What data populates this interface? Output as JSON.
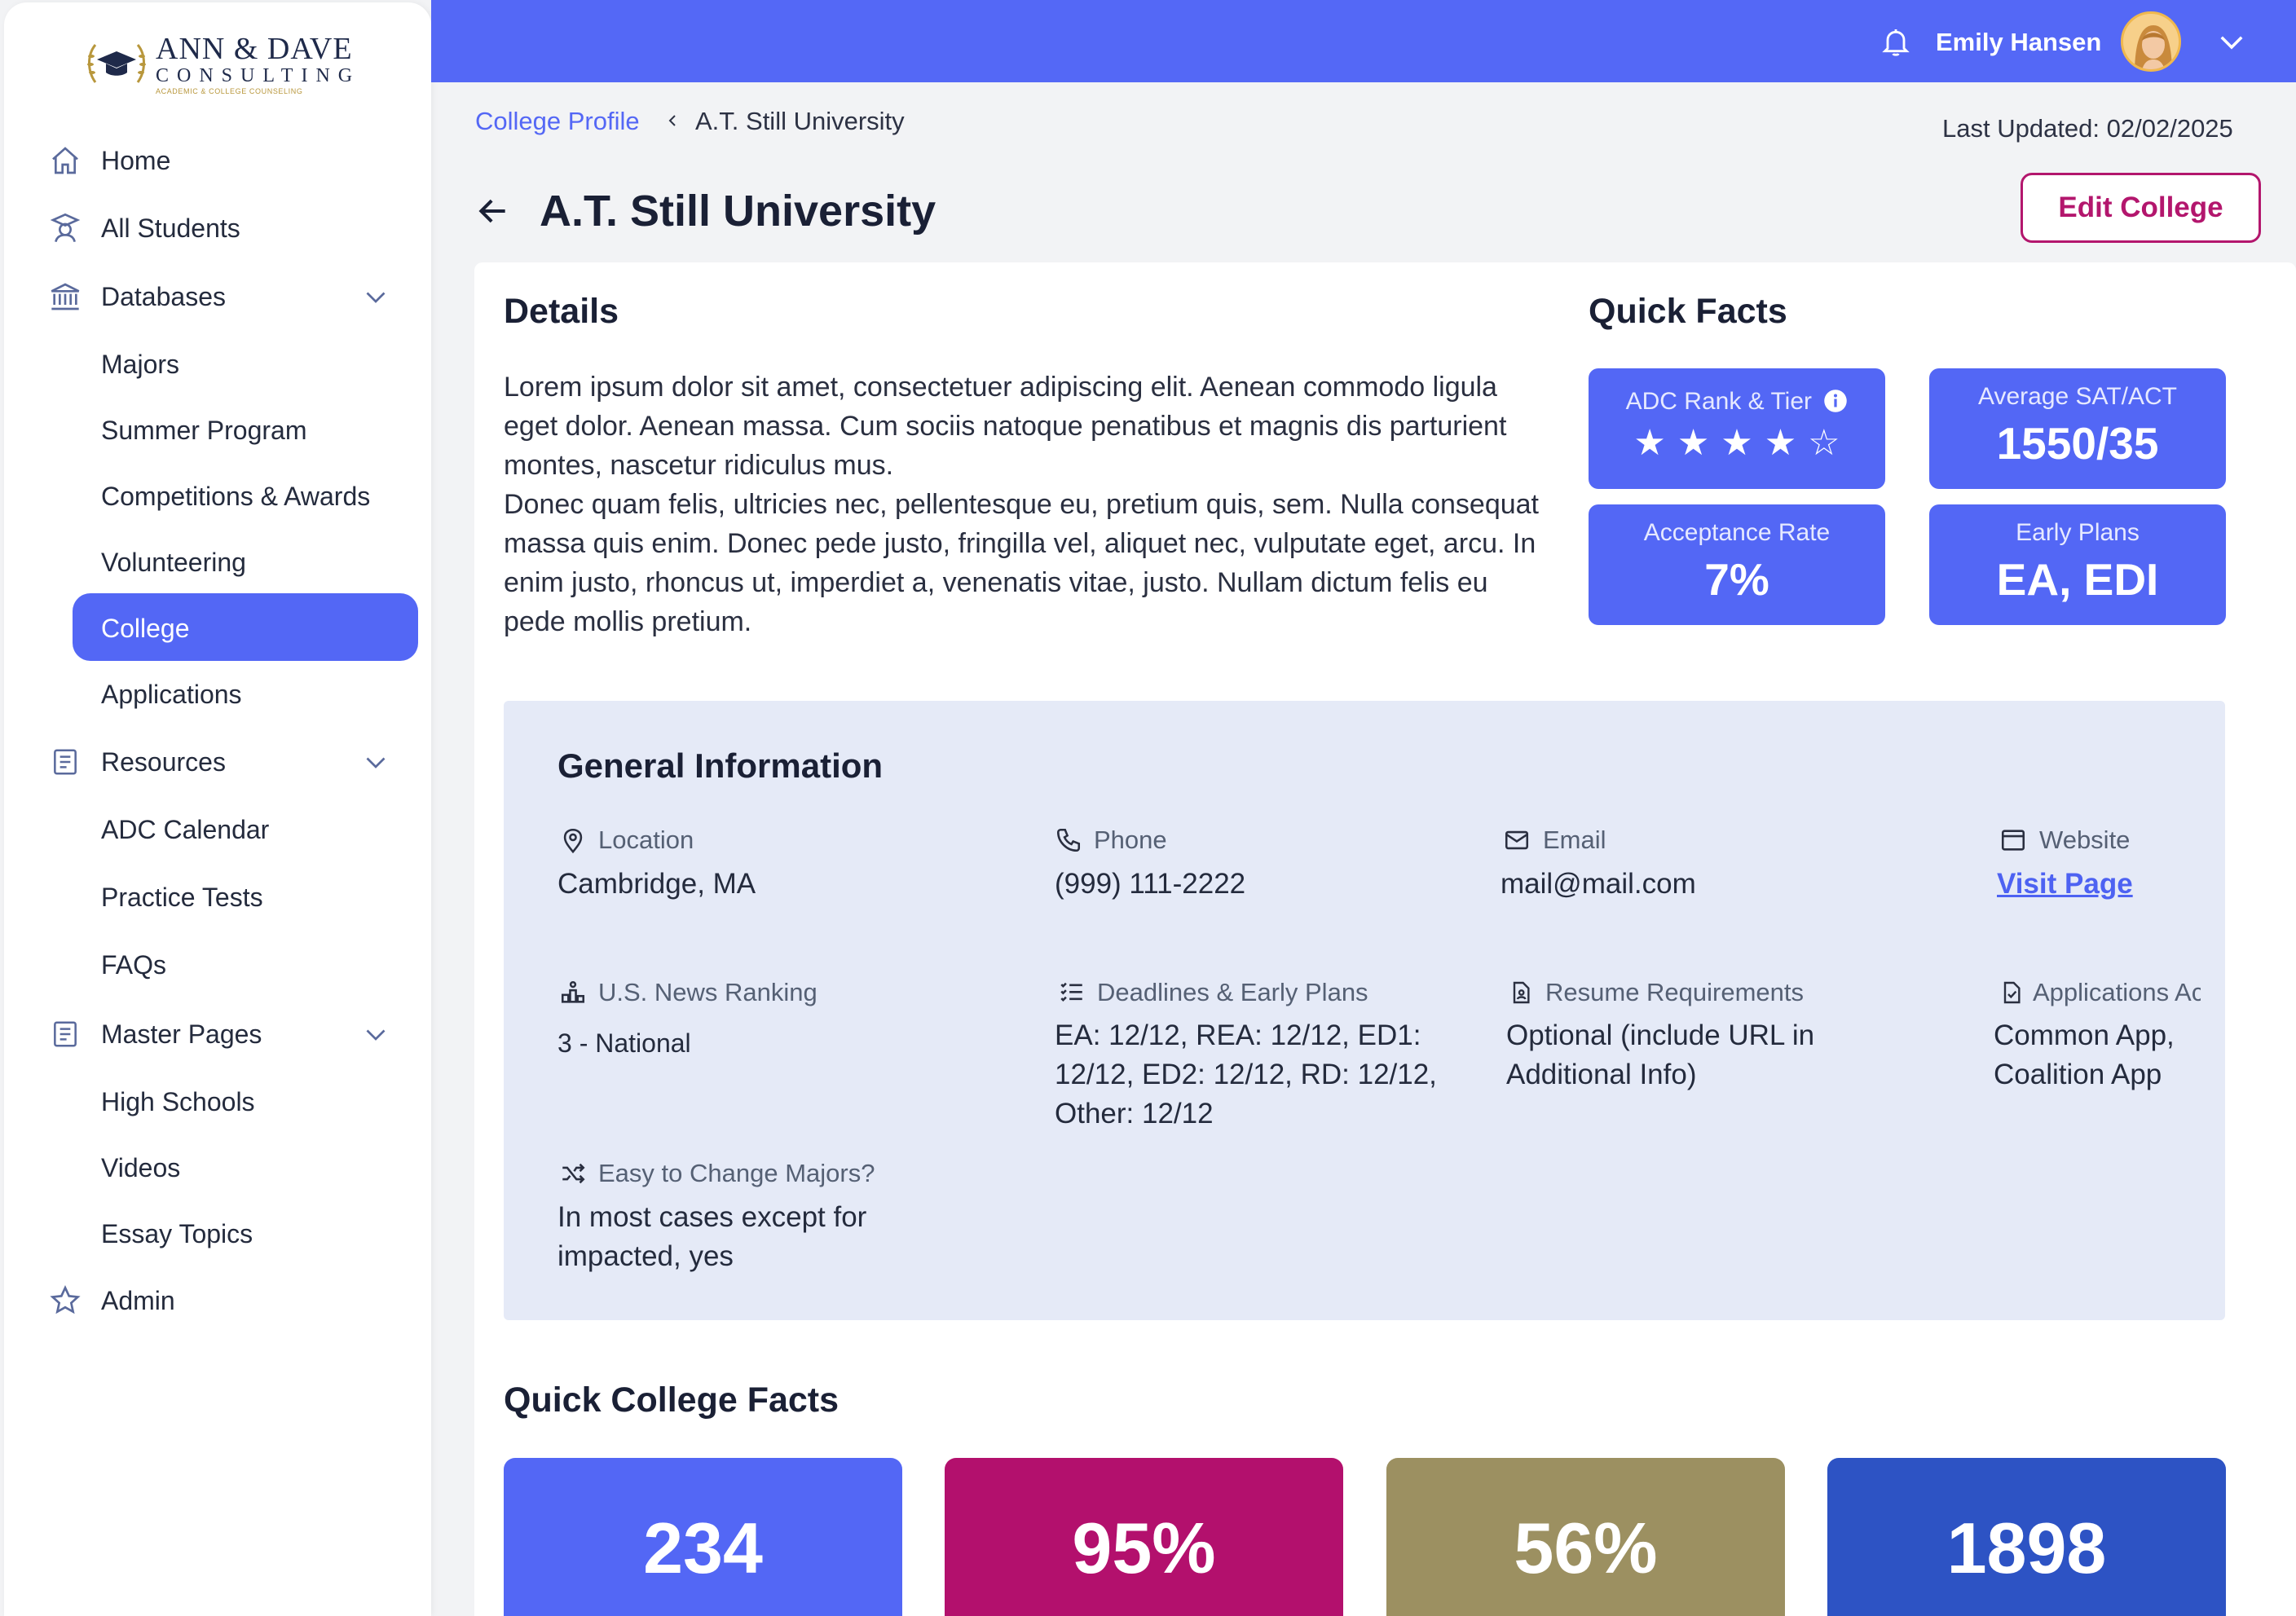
{
  "logo": {
    "line1": "ANN & DAVE",
    "line2": "CONSULTING",
    "line3": "ACADEMIC & COLLEGE COUNSELING"
  },
  "sidebar": {
    "items": [
      {
        "label": "Home",
        "icon": "home-icon"
      },
      {
        "label": "All Students",
        "icon": "student-icon"
      },
      {
        "label": "Databases",
        "icon": "bank-icon"
      },
      {
        "label": "Majors"
      },
      {
        "label": "Summer Program"
      },
      {
        "label": "Competitions & Awards"
      },
      {
        "label": "Volunteering"
      },
      {
        "label": "College"
      },
      {
        "label": "Applications"
      },
      {
        "label": "Resources",
        "icon": "document-icon"
      },
      {
        "label": "ADC Calendar"
      },
      {
        "label": "Practice Tests"
      },
      {
        "label": "FAQs"
      },
      {
        "label": "Master Pages",
        "icon": "document-icon"
      },
      {
        "label": "High Schools"
      },
      {
        "label": "Videos"
      },
      {
        "label": "Essay Topics"
      },
      {
        "label": "Admin",
        "icon": "star-icon"
      }
    ]
  },
  "header": {
    "user_name": "Emily Hansen",
    "accent": "#5468f6"
  },
  "breadcrumb": {
    "parent": "College Profile",
    "current": "A.T. Still University"
  },
  "last_updated": "Last Updated: 02/02/2025",
  "page_title": "A.T. Still University",
  "edit_button": "Edit College",
  "details": {
    "heading": "Details",
    "paragraph1": "Lorem ipsum dolor sit amet, consectetuer adipiscing elit. Aenean commodo ligula eget dolor. Aenean massa. Cum sociis natoque penatibus et magnis dis parturient montes, nascetur ridiculus mus.",
    "paragraph2": "Donec quam felis, ultricies nec, pellentesque eu, pretium quis, sem. Nulla consequat massa quis enim. Donec pede justo, fringilla vel, aliquet nec, vulputate eget, arcu. In enim justo, rhoncus ut, imperdiet a, venenatis vitae, justo. Nullam dictum felis eu pede mollis pretium."
  },
  "quick_facts": {
    "heading": "Quick Facts",
    "rank_label": "ADC Rank & Tier",
    "rank_stars": 4,
    "rank_stars_max": 5,
    "sat_label": "Average SAT/ACT",
    "sat_value": "1550/35",
    "acceptance_label": "Acceptance Rate",
    "acceptance_value": "7%",
    "early_label": "Early Plans",
    "early_value": "EA, EDI"
  },
  "general": {
    "heading": "General Information",
    "location_label": "Location",
    "location_value": "Cambridge, MA",
    "phone_label": "Phone",
    "phone_value": "(999) 111-2222",
    "email_label": "Email",
    "email_value": "mail@mail.com",
    "website_label": "Website",
    "website_value": "Visit Page",
    "ranking_label": "U.S. News Ranking",
    "ranking_value": "3 - National",
    "deadlines_label": "Deadlines & Early Plans",
    "deadlines_value": "EA: 12/12, REA: 12/12, ED1: 12/12, ED2: 12/12, RD: 12/12, Other: 12/12",
    "resume_label": "Resume Requirements",
    "resume_value": "Optional (include URL in Additional Info)",
    "apps_label": "Applications Accepted",
    "apps_value": "Common App, Coalition App",
    "majors_label": "Easy to Change Majors?",
    "majors_value": "In most cases except for impacted, yes"
  },
  "college_facts": {
    "heading": "Quick College Facts",
    "cards": [
      {
        "value": "234",
        "color": "#5367f5"
      },
      {
        "value": "95%",
        "color": "#b3106d"
      },
      {
        "value": "56%",
        "color": "#9c9061"
      },
      {
        "value": "1898",
        "color": "#2d53c4"
      }
    ]
  }
}
